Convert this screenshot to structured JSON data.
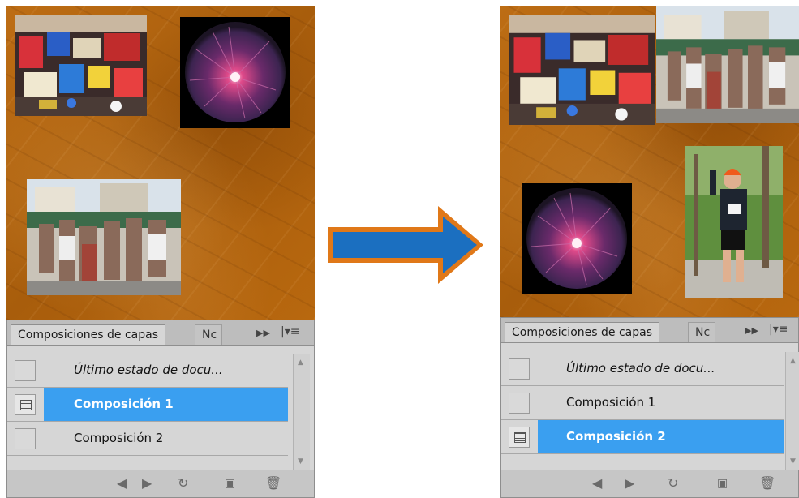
{
  "left_panel": {
    "tabs": [
      "Composiciones de capas",
      "Nc"
    ],
    "rows": [
      {
        "label": "Último estado de docu...",
        "checked": false,
        "selected": false
      },
      {
        "label": "Composición 1",
        "checked": true,
        "selected": true
      },
      {
        "label": "Composición 2",
        "checked": false,
        "selected": false
      }
    ]
  },
  "right_panel": {
    "tabs": [
      "Composiciones de capas",
      "Nc"
    ],
    "rows": [
      {
        "label": "Último estado de docu...",
        "checked": false,
        "selected": false
      },
      {
        "label": "Composición 1",
        "checked": false,
        "selected": false
      },
      {
        "label": "Composición 2",
        "checked": true,
        "selected": true
      }
    ]
  },
  "icons": {
    "panel_forward": "double-chevron-right",
    "panel_menu": "panel-menu",
    "footer": [
      "previous-arrow",
      "next-arrow",
      "update",
      "new-composition",
      "trash"
    ]
  },
  "colors": {
    "canvas_background": "#b5650f",
    "selection": "#3a9ff0",
    "arrow_fill": "#1b6fc0",
    "arrow_border": "#e07818"
  }
}
